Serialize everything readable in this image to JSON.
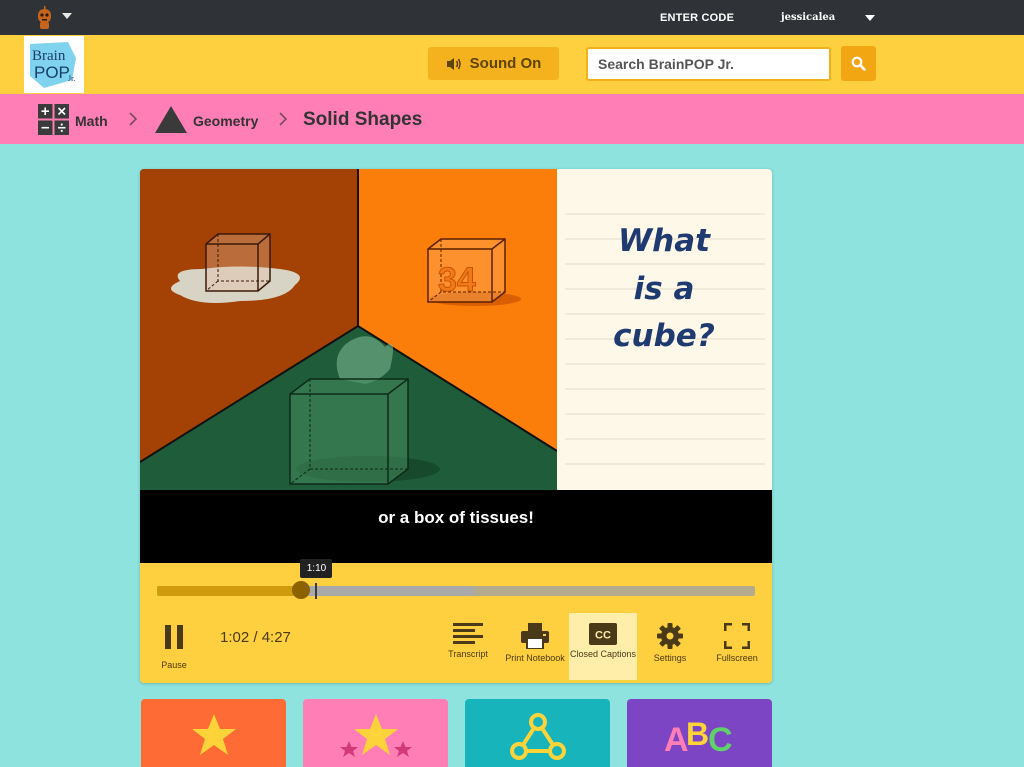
{
  "topbar": {
    "avatar_icon": "robot-avatar-icon",
    "enter_code_label": "ENTER CODE",
    "username": "jessicalea"
  },
  "header": {
    "logo_icon": "brainpop-jr-logo",
    "sound_button_label": "Sound On",
    "search_placeholder": "Search BrainPOP Jr.",
    "search_icon": "search-icon"
  },
  "breadcrumb": {
    "items": [
      {
        "label": "Math",
        "icon": "math-symbols-icon"
      },
      {
        "label": "Geometry",
        "icon": "triangle-icon"
      },
      {
        "label": "Solid Shapes"
      }
    ]
  },
  "player": {
    "video_text": "What is a cube?",
    "cube_label": "34",
    "caption": "or a box of tissues!",
    "hover_time": "1:10",
    "played_fraction": 0.241,
    "buffered_fraction": 0.53,
    "hover_fraction": 0.265,
    "time_display": "1:02 / 4:27",
    "controls": [
      {
        "key": "pause",
        "label": "Pause",
        "icon": "pause-icon"
      },
      {
        "key": "transcript",
        "label": "Transcript",
        "icon": "transcript-icon"
      },
      {
        "key": "print",
        "label": "Print Notebook",
        "icon": "printer-icon"
      },
      {
        "key": "cc",
        "label": "Closed Captions",
        "icon": "closed-captions-icon",
        "active": true
      },
      {
        "key": "settings",
        "label": "Settings",
        "icon": "gear-icon"
      },
      {
        "key": "fullscreen",
        "label": "Fullscreen",
        "icon": "fullscreen-icon"
      }
    ]
  },
  "cards": [
    {
      "icon": "star-icon",
      "color": "#ff6b35"
    },
    {
      "icon": "stars-icon",
      "color": "#ff7eb6"
    },
    {
      "icon": "connected-nodes-icon",
      "color": "#17b5bb"
    },
    {
      "icon": "abc-letters-icon",
      "color": "#7c45c4"
    }
  ],
  "colors": {
    "background": "#8ee3df",
    "topbar": "#2f3337",
    "header": "#fecf3f",
    "breadcrumb": "#ff7eb6",
    "accent": "#f2a712"
  }
}
